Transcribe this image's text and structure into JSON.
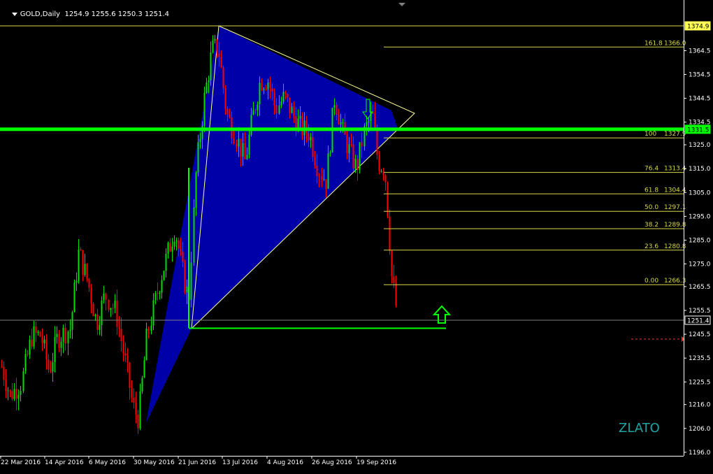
{
  "header": {
    "symbol": "GOLD,Daily",
    "ohlc": "1254.9 1255.6 1250.3 1251.4"
  },
  "watermark": "ZLATO",
  "chart_data": {
    "type": "candlestick",
    "symbol": "GOLD",
    "timeframe": "Daily",
    "ohlc_last": {
      "open": 1254.9,
      "high": 1255.6,
      "low": 1250.3,
      "close": 1251.4
    },
    "ylim": [
      1196.0,
      1384.0
    ],
    "y_ticks": [
      1196.0,
      1206.0,
      1216.0,
      1225.5,
      1235.5,
      1245.5,
      1255.5,
      1265.5,
      1275.0,
      1285.0,
      1295.0,
      1305.0,
      1315.0,
      1325.0,
      1334.5,
      1344.5,
      1354.5,
      1364.5
    ],
    "x_ticks": [
      "22 Mar 2016",
      "14 Apr 2016",
      "6 May 2016",
      "30 May 2016",
      "21 Jun 2016",
      "13 Jul 2016",
      "4 Aug 2016",
      "26 Aug 2016",
      "19 Sep 2016"
    ],
    "price_labels": [
      {
        "value": 1374.9,
        "text": "1374.9",
        "style": "yellow"
      },
      {
        "value": 1331.5,
        "text": "1331.5",
        "style": "green"
      },
      {
        "value": 1251.4,
        "text": "1251.4",
        "style": "white"
      }
    ],
    "horizontal_lines": [
      {
        "value": 1374.9,
        "color": "#d8d84a"
      },
      {
        "value": 1331.5,
        "color": "#00ff00"
      },
      {
        "value": 1251.4,
        "color": "#808080"
      }
    ],
    "fibonacci": {
      "levels": [
        {
          "ratio": "161.8",
          "price": "1366.0",
          "value": 1366.0
        },
        {
          "ratio": "100",
          "price": "1327.9",
          "value": 1327.9
        },
        {
          "ratio": "76.4",
          "price": "1313.4",
          "value": 1313.4
        },
        {
          "ratio": "61.8",
          "price": "1304.4",
          "value": 1304.4
        },
        {
          "ratio": "50.0",
          "price": "1297.1",
          "value": 1297.1
        },
        {
          "ratio": "38.2",
          "price": "1289.8",
          "value": 1289.8
        },
        {
          "ratio": "23.6",
          "price": "1280.8",
          "value": 1280.8
        },
        {
          "ratio": "0.00",
          "price": "1266.3",
          "value": 1266.3
        }
      ]
    },
    "colors": {
      "bull": "#00e000",
      "bear": "#ff0000",
      "triangle": "#0000a8",
      "fib": "#d8d84a",
      "support": "#00ff00",
      "axis": "#ffffff"
    },
    "annotations": [
      "upward-arrow",
      "support-line-1249",
      "triangle-pattern"
    ]
  }
}
